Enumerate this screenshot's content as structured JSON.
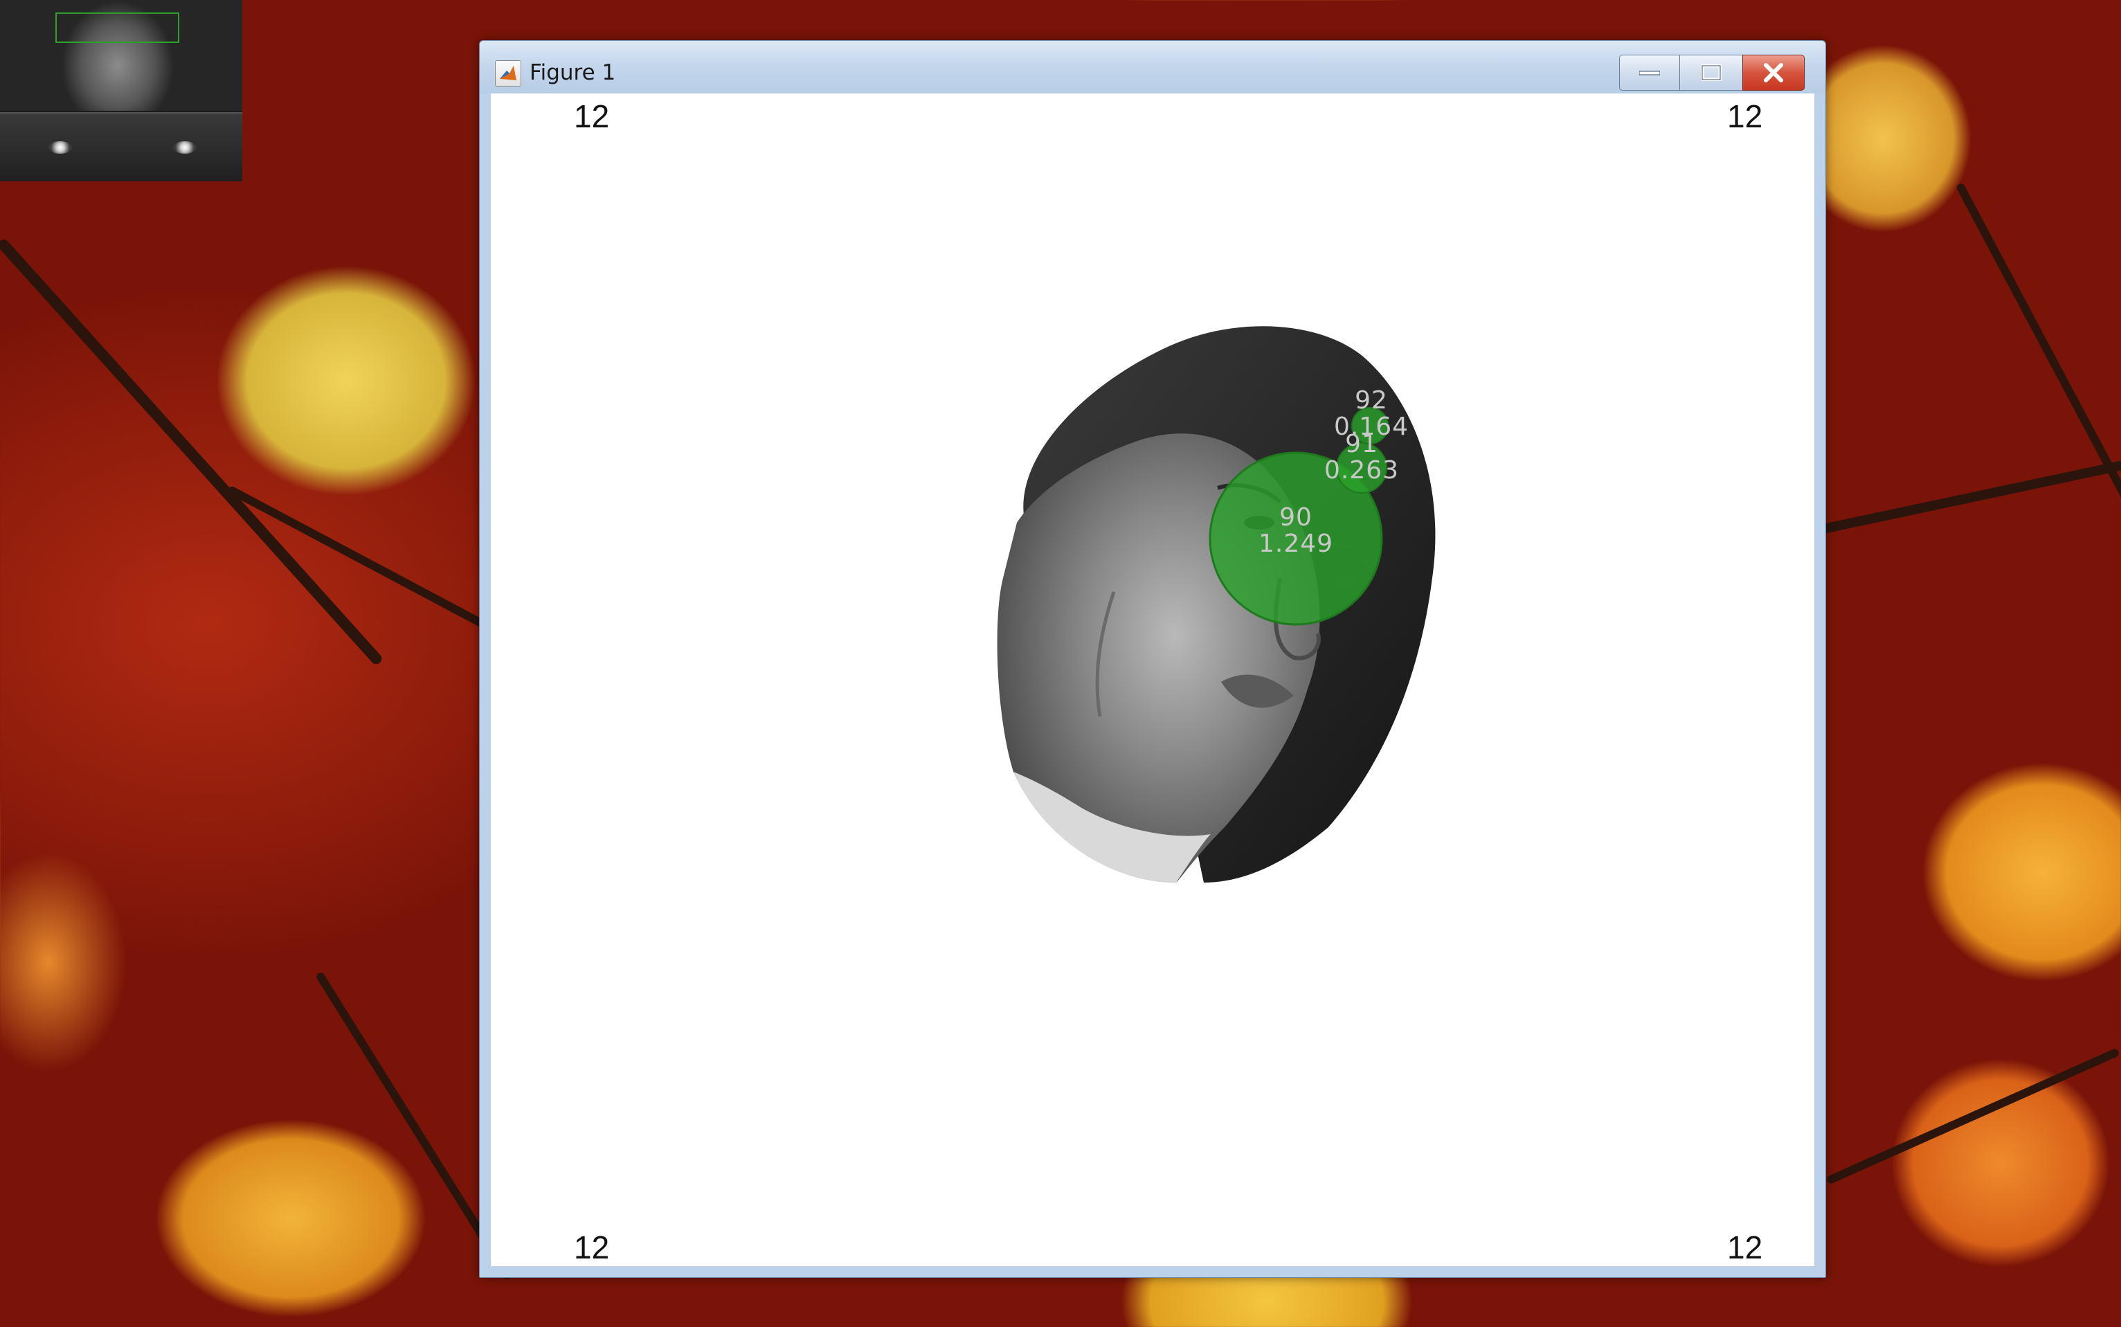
{
  "window": {
    "title": "Figure 1",
    "app_icon": "matlab-icon",
    "controls": [
      "minimize-icon",
      "maximize-icon",
      "close-icon"
    ]
  },
  "corners": {
    "top_left": "12",
    "top_right": "12",
    "bottom_left": "12",
    "bottom_right": "12"
  },
  "fixations": [
    {
      "id": "90",
      "duration": "1.249"
    },
    {
      "id": "91",
      "duration": "0.263"
    },
    {
      "id": "92",
      "duration": "0.164"
    }
  ],
  "colors": {
    "fixation_fill": "#2aa02a",
    "close_button": "#c8361f",
    "titlebar": "#c3d6ec"
  }
}
